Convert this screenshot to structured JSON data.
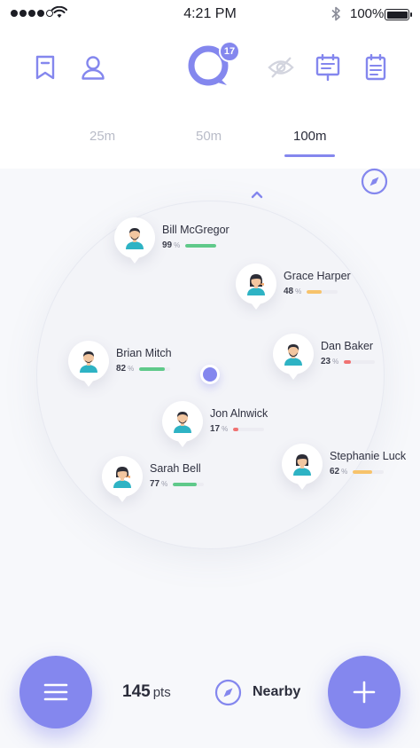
{
  "status_bar": {
    "time": "4:21 PM",
    "battery": "100%"
  },
  "header": {
    "chat_badge": "17",
    "icons": [
      "bookmark-icon",
      "profile-icon",
      "chat-icon",
      "hidden-eye-icon",
      "event-board-icon",
      "calendar-icon"
    ]
  },
  "tabs": [
    {
      "label": "25m",
      "active": false
    },
    {
      "label": "50m",
      "active": false
    },
    {
      "label": "100m",
      "active": true
    }
  ],
  "people": [
    {
      "name": "Bill McGregor",
      "score": "99",
      "pct": "%",
      "level": 0.99,
      "color": "#5fc98a"
    },
    {
      "name": "Grace Harper",
      "score": "48",
      "pct": "%",
      "level": 0.48,
      "color": "#f7c36b"
    },
    {
      "name": "Brian Mitch",
      "score": "82",
      "pct": "%",
      "level": 0.82,
      "color": "#5fc98a"
    },
    {
      "name": "Dan Baker",
      "score": "23",
      "pct": "%",
      "level": 0.23,
      "color": "#f07272"
    },
    {
      "name": "Jon Alnwick",
      "score": "17",
      "pct": "%",
      "level": 0.17,
      "color": "#f07272"
    },
    {
      "name": "Sarah Bell",
      "score": "77",
      "pct": "%",
      "level": 0.77,
      "color": "#5fc98a"
    },
    {
      "name": "Stephanie Luck",
      "score": "62",
      "pct": "%",
      "level": 0.62,
      "color": "#f7c36b"
    }
  ],
  "footer": {
    "points_value": "145",
    "points_unit": "pts",
    "nearby_label": "Nearby"
  },
  "colors": {
    "accent": "#8487ee",
    "good": "#5fc98a",
    "medium": "#f7c36b",
    "low": "#f07272"
  }
}
